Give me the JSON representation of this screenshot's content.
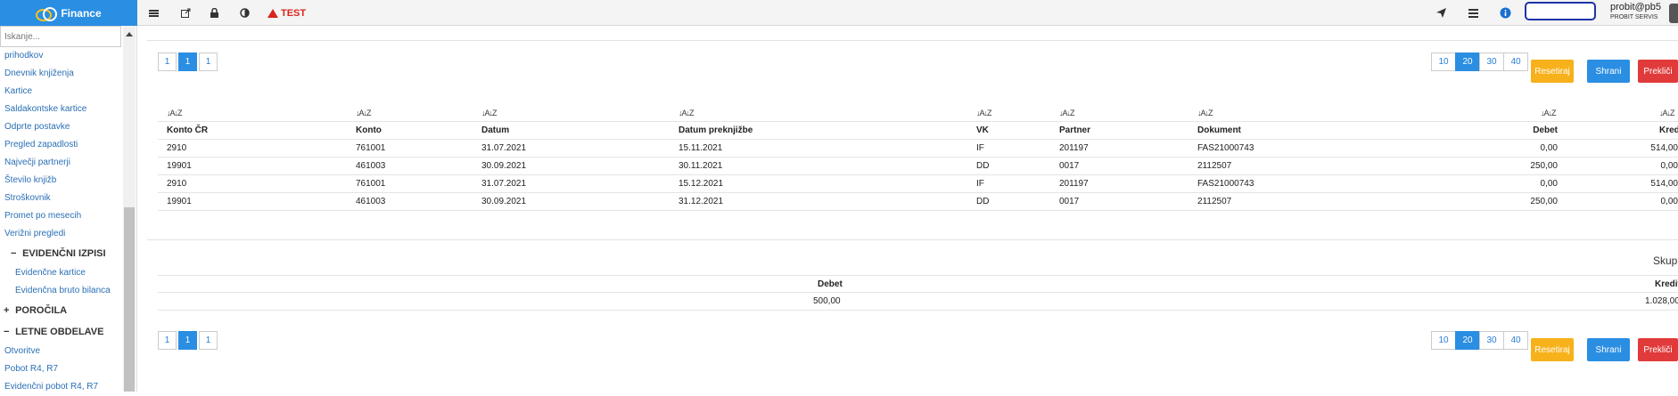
{
  "app": {
    "title": "Finance"
  },
  "toolbar": {
    "test_label": "TEST"
  },
  "user": {
    "name": "probit@pb5",
    "org": "PROBIT SERVIS"
  },
  "sidebar": {
    "search_placeholder": "Iskanje...",
    "items_top": [
      "prihodkov",
      "Dnevnik knjiženja",
      "Kartice",
      "Saldakontske kartice",
      "Odprte postavke",
      "Pregled zapadlosti",
      "Največji partnerji",
      "Število knjižb",
      "Stroškovnik",
      "Promet po mesecih",
      "Verižni pregledi"
    ],
    "group_evidencni": {
      "symbol": "−",
      "label": "EVIDENČNI IZPISI"
    },
    "items_evidencni": [
      "Evidenčne kartice",
      "Evidenčna bruto bilanca"
    ],
    "group_porocila": {
      "symbol": "+",
      "label": "POROČILA"
    },
    "group_letne": {
      "symbol": "−",
      "label": "LETNE OBDELAVE"
    },
    "items_letne": [
      "Otvoritve",
      "Pobot R4, R7",
      "Evidenčni pobot R4, R7"
    ]
  },
  "pager": {
    "buttons": [
      "1",
      "1",
      "1"
    ],
    "active_index": 1
  },
  "page_sizes": {
    "options": [
      "10",
      "20",
      "30",
      "40"
    ],
    "active_index": 1
  },
  "actions": {
    "reset": "Resetiraj",
    "save": "Shrani",
    "cancel": "Prekliči"
  },
  "table": {
    "sort_icon": "↓A↓Z",
    "columns": [
      "Konto ČR",
      "Konto",
      "Datum",
      "Datum preknjižbe",
      "VK",
      "Partner",
      "Dokument",
      "Debet",
      "Kredit"
    ],
    "rows": [
      [
        "2910",
        "761001",
        "31.07.2021",
        "15.11.2021",
        "IF",
        "201197",
        "FAS21000743",
        "0,00",
        "514,00"
      ],
      [
        "19901",
        "461003",
        "30.09.2021",
        "30.11.2021",
        "DD",
        "0017",
        "2112507",
        "250,00",
        "0,00"
      ],
      [
        "2910",
        "761001",
        "31.07.2021",
        "15.12.2021",
        "IF",
        "201197",
        "FAS21000743",
        "0,00",
        "514,00"
      ],
      [
        "19901",
        "461003",
        "30.09.2021",
        "31.12.2021",
        "DD",
        "0017",
        "2112507",
        "250,00",
        "0,00"
      ]
    ]
  },
  "totals": {
    "title": "Skupaj",
    "debet_label": "Debet",
    "kredit_label": "Kredit",
    "debet_value": "500,00",
    "kredit_value": "1.028,00"
  }
}
